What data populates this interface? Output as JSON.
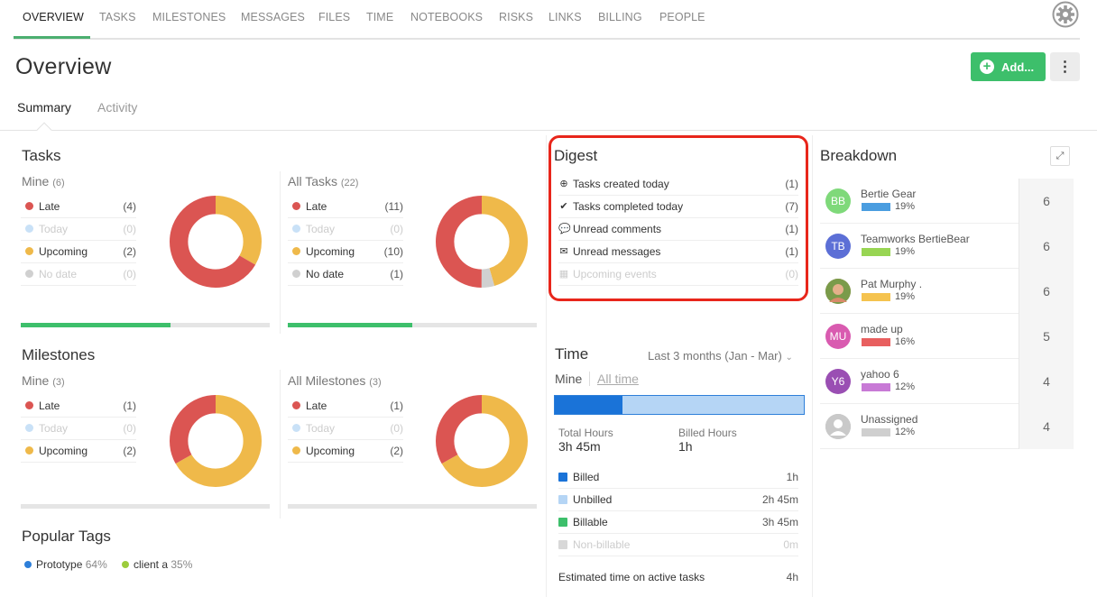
{
  "nav": {
    "tabs": [
      "OVERVIEW",
      "TASKS",
      "MILESTONES",
      "MESSAGES",
      "FILES",
      "TIME",
      "NOTEBOOKS",
      "RISKS",
      "LINKS",
      "BILLING",
      "PEOPLE"
    ],
    "active": "OVERVIEW"
  },
  "header": {
    "title": "Overview",
    "add_label": "Add...",
    "more_label": "⋮"
  },
  "subtabs": {
    "summary": "Summary",
    "activity": "Activity"
  },
  "colors": {
    "late": "#db5552",
    "today": "#c9e1f7",
    "upcoming": "#efb94a",
    "nodate": "#d0d0d0",
    "green": "#3dbf6b"
  },
  "tasks": {
    "title": "Tasks",
    "mine": {
      "label": "Mine",
      "count": "(6)",
      "rows": [
        {
          "label": "Late",
          "value": "(4)",
          "n": 4
        },
        {
          "label": "Today",
          "value": "(0)",
          "n": 0
        },
        {
          "label": "Upcoming",
          "value": "(2)",
          "n": 2
        },
        {
          "label": "No date",
          "value": "(0)",
          "n": 0
        }
      ],
      "progress": 0.6
    },
    "all": {
      "label": "All Tasks",
      "count": "(22)",
      "rows": [
        {
          "label": "Late",
          "value": "(11)",
          "n": 11
        },
        {
          "label": "Today",
          "value": "(0)",
          "n": 0
        },
        {
          "label": "Upcoming",
          "value": "(10)",
          "n": 10
        },
        {
          "label": "No date",
          "value": "(1)",
          "n": 1
        }
      ],
      "progress": 0.5
    }
  },
  "milestones": {
    "title": "Milestones",
    "mine": {
      "label": "Mine",
      "count": "(3)",
      "rows": [
        {
          "label": "Late",
          "value": "(1)",
          "n": 1
        },
        {
          "label": "Today",
          "value": "(0)",
          "n": 0
        },
        {
          "label": "Upcoming",
          "value": "(2)",
          "n": 2
        }
      ]
    },
    "all": {
      "label": "All Milestones",
      "count": "(3)",
      "rows": [
        {
          "label": "Late",
          "value": "(1)",
          "n": 1
        },
        {
          "label": "Today",
          "value": "(0)",
          "n": 0
        },
        {
          "label": "Upcoming",
          "value": "(2)",
          "n": 2
        }
      ]
    }
  },
  "popular_tags": {
    "title": "Popular Tags",
    "tags": [
      {
        "name": "Prototype",
        "pct": "64%",
        "color": "#2e7fd9"
      },
      {
        "name": "client a",
        "pct": "35%",
        "color": "#9ccc3c"
      }
    ]
  },
  "digest": {
    "title": "Digest",
    "rows": [
      {
        "icon": "plus-circle-icon",
        "glyph": "⊕",
        "label": "Tasks created today",
        "value": "(1)"
      },
      {
        "icon": "check-circle-icon",
        "glyph": "✔",
        "label": "Tasks completed today",
        "value": "(7)"
      },
      {
        "icon": "comments-icon",
        "glyph": "💬",
        "label": "Unread comments",
        "value": "(1)"
      },
      {
        "icon": "envelope-icon",
        "glyph": "✉",
        "label": "Unread messages",
        "value": "(1)"
      },
      {
        "icon": "calendar-icon",
        "glyph": "▦",
        "label": "Upcoming events",
        "value": "(0)"
      }
    ]
  },
  "time": {
    "title": "Time",
    "range": "Last 3 months (Jan - Mar)",
    "filter_mine": "Mine",
    "filter_all": "All time",
    "bar_fill": 0.27,
    "total_label": "Total Hours",
    "total_value": "3h 45m",
    "billed_label": "Billed Hours",
    "billed_value": "1h",
    "rows": [
      {
        "label": "Billed",
        "value": "1h",
        "color": "#1a73d8"
      },
      {
        "label": "Unbilled",
        "value": "2h 45m",
        "color": "#b5d5f5"
      },
      {
        "label": "Billable",
        "value": "3h 45m",
        "color": "#3dbf6b"
      },
      {
        "label": "Non-billable",
        "value": "0m",
        "color": "#d8d8d8"
      }
    ],
    "estimated_label": "Estimated time on active tasks",
    "estimated_value": "4h"
  },
  "breakdown": {
    "title": "Breakdown",
    "people": [
      {
        "initials": "BB",
        "name": "Bertie Gear",
        "pct": "19%",
        "count": "6",
        "avatar_color": "#7fd97a",
        "bar_color": "#4a9de0"
      },
      {
        "initials": "TB",
        "name": "Teamworks BertieBear",
        "pct": "19%",
        "count": "6",
        "avatar_color": "#5c6fd6",
        "bar_color": "#98d553"
      },
      {
        "initials": "",
        "name": "Pat Murphy .",
        "pct": "19%",
        "count": "6",
        "avatar_color": "#c48a5a",
        "bar_color": "#f5c34f"
      },
      {
        "initials": "MU",
        "name": "made up",
        "pct": "16%",
        "count": "5",
        "avatar_color": "#d95bb0",
        "bar_color": "#e85f5f"
      },
      {
        "initials": "Y6",
        "name": "yahoo 6",
        "pct": "12%",
        "count": "4",
        "avatar_color": "#9a4fb3",
        "bar_color": "#c87ad6"
      },
      {
        "initials": "",
        "name": "Unassigned",
        "pct": "12%",
        "count": "4",
        "avatar_color": "#bdbdbd",
        "bar_color": "#cfcfcf"
      }
    ]
  }
}
